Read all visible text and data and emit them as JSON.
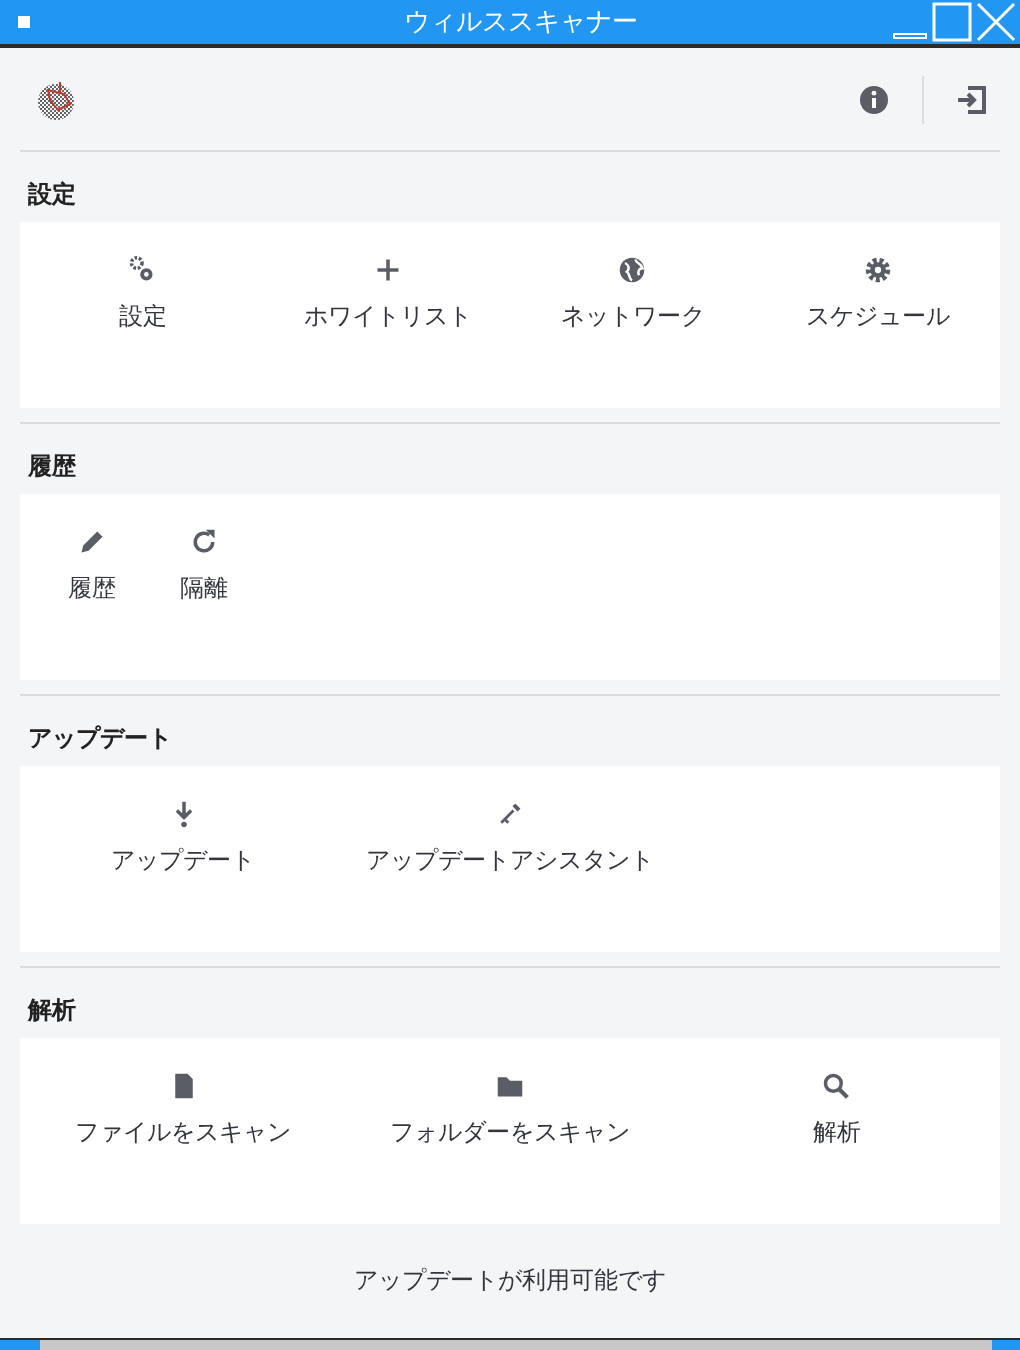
{
  "window": {
    "title": "ウィルススキャナー"
  },
  "sections": [
    {
      "title": "設定",
      "items": [
        {
          "label": "設定"
        },
        {
          "label": "ホワイトリスト"
        },
        {
          "label": "ネットワーク"
        },
        {
          "label": "スケジュール"
        }
      ]
    },
    {
      "title": "履歴",
      "items": [
        {
          "label": "履歴"
        },
        {
          "label": "隔離"
        }
      ]
    },
    {
      "title": "アップデート",
      "items": [
        {
          "label": "アップデート"
        },
        {
          "label": "アップデートアシスタント"
        }
      ]
    },
    {
      "title": "解析",
      "items": [
        {
          "label": "ファイルをスキャン"
        },
        {
          "label": "フォルダーをスキャン"
        },
        {
          "label": "解析"
        }
      ]
    }
  ],
  "status": "アップデートが利用可能です"
}
